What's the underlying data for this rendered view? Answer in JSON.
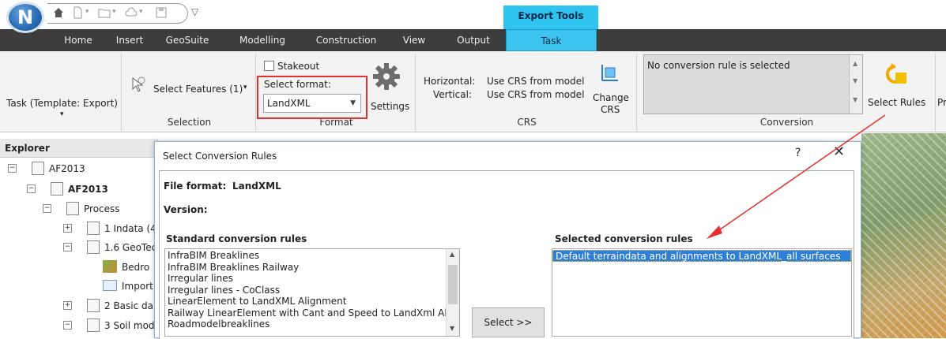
{
  "app": {
    "logo_letter": "N"
  },
  "quick_access": {
    "icons": [
      "home-icon",
      "new-icon",
      "open-icon",
      "cloud-icon",
      "save-icon"
    ],
    "customize_label": "▽"
  },
  "context_tab_header": "Export Tools",
  "tabs": [
    "Home",
    "Insert",
    "GeoSuite",
    "Modelling",
    "Construction",
    "View",
    "Output",
    "Task"
  ],
  "active_tab": "Task",
  "ribbon": {
    "task": {
      "label": "Task  (Template: Export)",
      "arrow": "▾"
    },
    "selection": {
      "select_features": "Select Features (1)",
      "arrow": "▾",
      "group_label": "Selection"
    },
    "format": {
      "stakeout_label": "Stakeout",
      "select_format_label": "Select format:",
      "format_value": "LandXML",
      "settings_label": "Settings",
      "group_label": "Format"
    },
    "crs": {
      "horizontal_label": "Horizontal:",
      "horizontal_value": "Use CRS from model",
      "vertical_label": "Vertical:",
      "vertical_value": "Use CRS from model",
      "change_crs_line1": "Change",
      "change_crs_line2": "CRS",
      "group_label": "CRS"
    },
    "conversion": {
      "status": "No conversion rule is selected",
      "select_rules_label": "Select Rules",
      "group_label": "Conversion",
      "next_label": "Pr"
    }
  },
  "explorer": {
    "title": "Explorer",
    "items": [
      {
        "label": "AF2013",
        "level": 0,
        "expander": "−"
      },
      {
        "label": "AF2013",
        "level": 1,
        "expander": "−",
        "bold": true
      },
      {
        "label": "Process",
        "level": 2,
        "expander": "−"
      },
      {
        "label": "1 Indata (4",
        "level": 3,
        "expander": "+"
      },
      {
        "label": "1.6 GeoTec",
        "level": 3,
        "expander": "−"
      },
      {
        "label": "Bedro",
        "level": 4,
        "expander": ""
      },
      {
        "label": "Import",
        "level": 4,
        "expander": ""
      },
      {
        "label": "2 Basic da",
        "level": 3,
        "expander": "+"
      },
      {
        "label": "3 Soil mod",
        "level": 3,
        "expander": "−"
      }
    ]
  },
  "dialog": {
    "title": "Select Conversion Rules",
    "help": "?",
    "close": "✕",
    "file_format_label": "File format:",
    "file_format_value": "LandXML",
    "version_label": "Version:",
    "standard_rules_header": "Standard conversion rules",
    "standard_rules": [
      "InfraBIM Breaklines",
      "InfraBIM Breaklines Railway",
      "Irregular lines",
      "Irregular lines - CoClass",
      "LinearElement to LandXML Alignment",
      "Railway LinearElement with Cant and Speed to LandXml Al",
      "Roadmodelbreaklines"
    ],
    "select_button": "Select >>",
    "selected_rules_header": "Selected conversion rules",
    "selected_rules": [
      "Default terraindata and alignments to LandXML_all surfaces"
    ]
  },
  "colors": {
    "accent_tab": "#3cc4ef",
    "highlight_box": "#e53030",
    "arrow": "#e53030",
    "selection": "#2f7fd6"
  }
}
